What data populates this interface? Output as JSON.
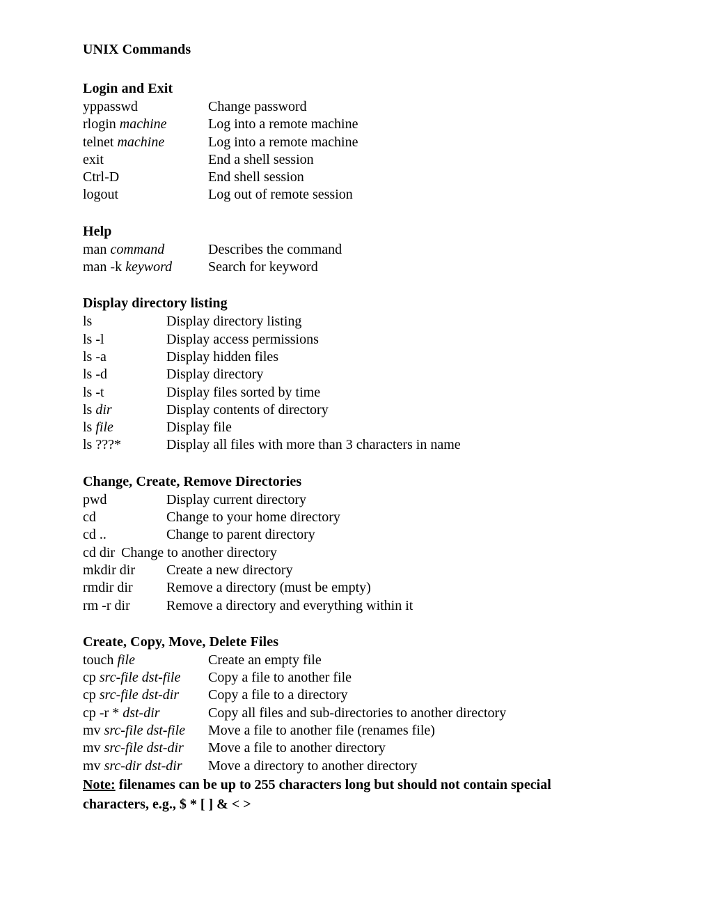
{
  "document": {
    "title": "UNIX Commands",
    "note": {
      "label": "Note:",
      "text": " filenames can be up to 255 characters long but should not contain special characters, e.g., $ * [ ] & < >"
    }
  },
  "sections": [
    {
      "heading": "Login and Exit",
      "tab": "180",
      "rows": [
        {
          "cmd": "yppasswd",
          "arg": "",
          "desc": "Change password"
        },
        {
          "cmd": "rlogin ",
          "arg": "machine",
          "desc": "Log into a remote machine"
        },
        {
          "cmd": "telnet ",
          "arg": "machine",
          "desc": "Log into a remote machine"
        },
        {
          "cmd": "exit",
          "arg": "",
          "desc": "End a shell session"
        },
        {
          "cmd": "Ctrl-D",
          "arg": "",
          "desc": "End shell session"
        },
        {
          "cmd": "logout",
          "arg": "",
          "desc": "Log out of remote session"
        }
      ]
    },
    {
      "heading": "Help",
      "tab": "180",
      "rows": [
        {
          "cmd": "man ",
          "arg": "command",
          "desc": "Describes the command"
        },
        {
          "cmd": "man -k ",
          "arg": "keyword",
          "desc": "Search for keyword"
        }
      ]
    },
    {
      "heading": "Display directory listing",
      "tab": "120",
      "rows": [
        {
          "cmd": "ls",
          "arg": "",
          "desc": "Display directory listing"
        },
        {
          "cmd": "ls -l",
          "arg": "",
          "desc": "Display access permissions"
        },
        {
          "cmd": "ls -a",
          "arg": "",
          "desc": "Display hidden files"
        },
        {
          "cmd": "ls -d",
          "arg": "",
          "desc": "Display directory"
        },
        {
          "cmd": "ls -t",
          "arg": "",
          "desc": "Display files sorted by time"
        },
        {
          "cmd": "ls ",
          "arg": "dir",
          "desc": "Display contents of directory"
        },
        {
          "cmd": "ls ",
          "arg": "file",
          "desc": "Display file"
        },
        {
          "cmd": "ls ???*",
          "arg": "",
          "desc": "Display all files with more than 3 characters in name"
        }
      ]
    },
    {
      "heading": "Change, Create, Remove Directories",
      "tab": "120",
      "rows": [
        {
          "cmd": "pwd",
          "arg": "",
          "desc": "Display current directory"
        },
        {
          "cmd": "cd",
          "arg": "",
          "desc": "Change to your home directory"
        },
        {
          "cmd": "cd ..",
          "arg": "",
          "desc": "Change to parent directory"
        },
        {
          "cmd": "cd dir",
          "arg": "",
          "desc": "Change to another directory",
          "inline": true
        },
        {
          "cmd": "mkdir dir",
          "arg": "",
          "desc": "Create a new directory"
        },
        {
          "cmd": "rmdir dir",
          "arg": "",
          "desc": "Remove a directory (must be empty)"
        },
        {
          "cmd": "rm -r dir",
          "arg": "",
          "desc": "Remove a directory and everything within it"
        }
      ]
    },
    {
      "heading": "Create, Copy, Move, Delete Files",
      "tab": "180",
      "rows": [
        {
          "cmd": "touch ",
          "arg": "file",
          "desc": "Create an empty file"
        },
        {
          "cmd": "cp ",
          "arg": "src-file dst-file",
          "desc": "Copy a file to another file"
        },
        {
          "cmd": "cp ",
          "arg": "src-file dst-dir",
          "desc": "Copy a file to a directory"
        },
        {
          "cmd": "cp -r * ",
          "arg": "dst-dir",
          "desc": "Copy all files and sub-directories to another directory"
        },
        {
          "cmd": "mv  ",
          "arg": "src-file dst-file",
          "desc": "Move a file to another file (renames file)"
        },
        {
          "cmd": "mv  ",
          "arg": "src-file dst-dir",
          "desc": "Move a file to another directory"
        },
        {
          "cmd": "mv  ",
          "arg": "src-dir dst-dir",
          "desc": "Move a directory to another directory"
        }
      ]
    }
  ]
}
